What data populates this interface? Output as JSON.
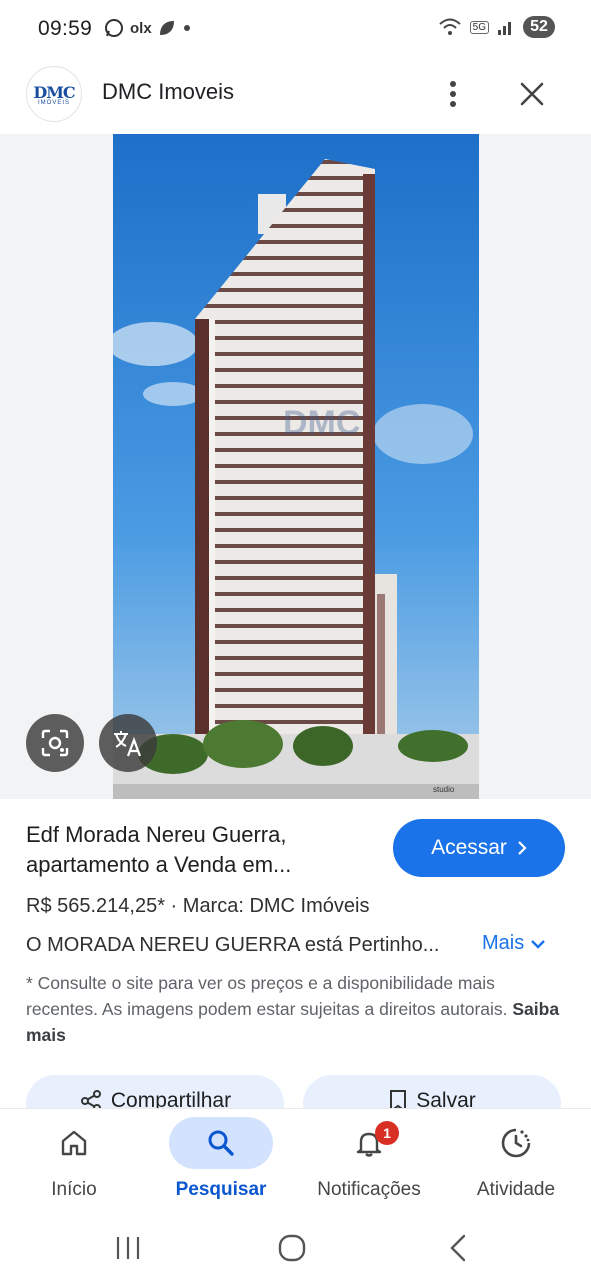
{
  "status_bar": {
    "time": "09:59",
    "left_icons": [
      "whatsapp-icon",
      "olx-icon",
      "leaf-icon",
      "dot-icon"
    ],
    "olx_label": "olx",
    "network": "5G",
    "battery": "52"
  },
  "header": {
    "site_name": "DMC Imoveis",
    "logo_text": "DMC",
    "logo_subtext": "IMOVEIS"
  },
  "image": {
    "watermark": "DMC",
    "credit": "studio"
  },
  "listing": {
    "title_line1": "Edf Morada Nereu Guerra,",
    "title_line2": "apartamento a Venda em...",
    "access_label": "Acessar",
    "price_line": "R$ 565.214,25* · Marca: DMC Imóveis",
    "description": "O MORADA NEREU GUERRA está Pertinho...",
    "more_label": "Mais",
    "disclaimer": "* Consulte o site para ver os preços e a disponibilidade mais recentes. As imagens podem estar sujeitas a direitos autorais.",
    "learn_more": "Saiba mais"
  },
  "actions": {
    "share_label": "Compartilhar",
    "save_label": "Salvar"
  },
  "bottom_nav": {
    "items": [
      {
        "label": "Início",
        "icon": "home-icon"
      },
      {
        "label": "Pesquisar",
        "icon": "search-icon",
        "active": true
      },
      {
        "label": "Notificações",
        "icon": "bell-icon",
        "badge": "1"
      },
      {
        "label": "Atividade",
        "icon": "activity-icon"
      }
    ]
  },
  "colors": {
    "accent": "#1a73e8",
    "active_nav_bg": "#d3e3fd",
    "badge": "#d93025"
  }
}
